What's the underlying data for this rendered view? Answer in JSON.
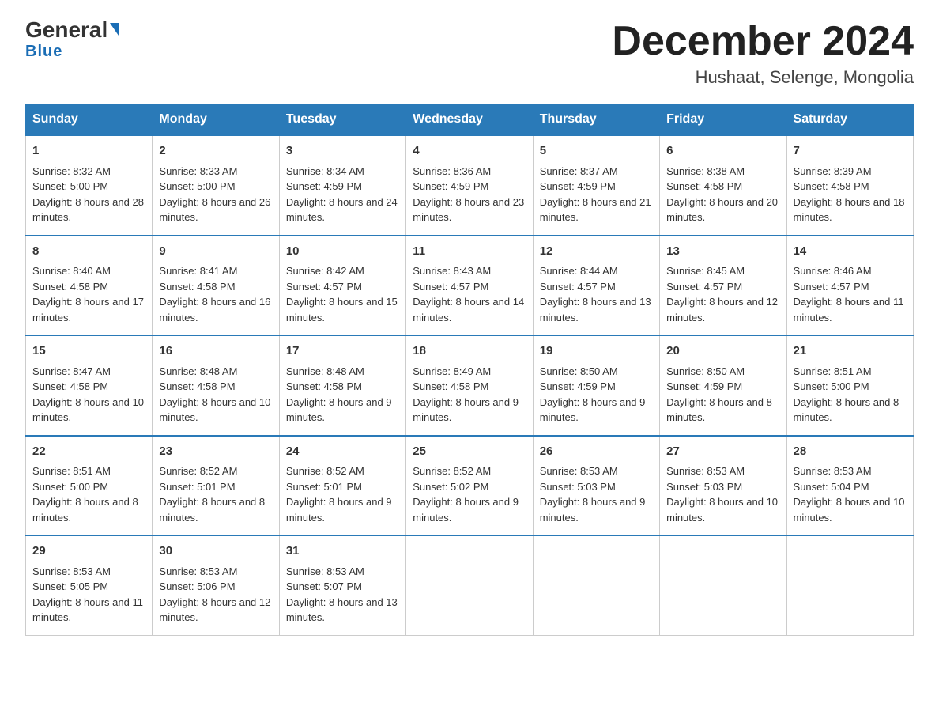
{
  "logo": {
    "general": "General",
    "blue": "Blue",
    "triangle_label": "logo-triangle"
  },
  "header": {
    "month_title": "December 2024",
    "location": "Hushaat, Selenge, Mongolia"
  },
  "days_of_week": [
    "Sunday",
    "Monday",
    "Tuesday",
    "Wednesday",
    "Thursday",
    "Friday",
    "Saturday"
  ],
  "weeks": [
    [
      {
        "day": "1",
        "sunrise": "Sunrise: 8:32 AM",
        "sunset": "Sunset: 5:00 PM",
        "daylight": "Daylight: 8 hours and 28 minutes."
      },
      {
        "day": "2",
        "sunrise": "Sunrise: 8:33 AM",
        "sunset": "Sunset: 5:00 PM",
        "daylight": "Daylight: 8 hours and 26 minutes."
      },
      {
        "day": "3",
        "sunrise": "Sunrise: 8:34 AM",
        "sunset": "Sunset: 4:59 PM",
        "daylight": "Daylight: 8 hours and 24 minutes."
      },
      {
        "day": "4",
        "sunrise": "Sunrise: 8:36 AM",
        "sunset": "Sunset: 4:59 PM",
        "daylight": "Daylight: 8 hours and 23 minutes."
      },
      {
        "day": "5",
        "sunrise": "Sunrise: 8:37 AM",
        "sunset": "Sunset: 4:59 PM",
        "daylight": "Daylight: 8 hours and 21 minutes."
      },
      {
        "day": "6",
        "sunrise": "Sunrise: 8:38 AM",
        "sunset": "Sunset: 4:58 PM",
        "daylight": "Daylight: 8 hours and 20 minutes."
      },
      {
        "day": "7",
        "sunrise": "Sunrise: 8:39 AM",
        "sunset": "Sunset: 4:58 PM",
        "daylight": "Daylight: 8 hours and 18 minutes."
      }
    ],
    [
      {
        "day": "8",
        "sunrise": "Sunrise: 8:40 AM",
        "sunset": "Sunset: 4:58 PM",
        "daylight": "Daylight: 8 hours and 17 minutes."
      },
      {
        "day": "9",
        "sunrise": "Sunrise: 8:41 AM",
        "sunset": "Sunset: 4:58 PM",
        "daylight": "Daylight: 8 hours and 16 minutes."
      },
      {
        "day": "10",
        "sunrise": "Sunrise: 8:42 AM",
        "sunset": "Sunset: 4:57 PM",
        "daylight": "Daylight: 8 hours and 15 minutes."
      },
      {
        "day": "11",
        "sunrise": "Sunrise: 8:43 AM",
        "sunset": "Sunset: 4:57 PM",
        "daylight": "Daylight: 8 hours and 14 minutes."
      },
      {
        "day": "12",
        "sunrise": "Sunrise: 8:44 AM",
        "sunset": "Sunset: 4:57 PM",
        "daylight": "Daylight: 8 hours and 13 minutes."
      },
      {
        "day": "13",
        "sunrise": "Sunrise: 8:45 AM",
        "sunset": "Sunset: 4:57 PM",
        "daylight": "Daylight: 8 hours and 12 minutes."
      },
      {
        "day": "14",
        "sunrise": "Sunrise: 8:46 AM",
        "sunset": "Sunset: 4:57 PM",
        "daylight": "Daylight: 8 hours and 11 minutes."
      }
    ],
    [
      {
        "day": "15",
        "sunrise": "Sunrise: 8:47 AM",
        "sunset": "Sunset: 4:58 PM",
        "daylight": "Daylight: 8 hours and 10 minutes."
      },
      {
        "day": "16",
        "sunrise": "Sunrise: 8:48 AM",
        "sunset": "Sunset: 4:58 PM",
        "daylight": "Daylight: 8 hours and 10 minutes."
      },
      {
        "day": "17",
        "sunrise": "Sunrise: 8:48 AM",
        "sunset": "Sunset: 4:58 PM",
        "daylight": "Daylight: 8 hours and 9 minutes."
      },
      {
        "day": "18",
        "sunrise": "Sunrise: 8:49 AM",
        "sunset": "Sunset: 4:58 PM",
        "daylight": "Daylight: 8 hours and 9 minutes."
      },
      {
        "day": "19",
        "sunrise": "Sunrise: 8:50 AM",
        "sunset": "Sunset: 4:59 PM",
        "daylight": "Daylight: 8 hours and 9 minutes."
      },
      {
        "day": "20",
        "sunrise": "Sunrise: 8:50 AM",
        "sunset": "Sunset: 4:59 PM",
        "daylight": "Daylight: 8 hours and 8 minutes."
      },
      {
        "day": "21",
        "sunrise": "Sunrise: 8:51 AM",
        "sunset": "Sunset: 5:00 PM",
        "daylight": "Daylight: 8 hours and 8 minutes."
      }
    ],
    [
      {
        "day": "22",
        "sunrise": "Sunrise: 8:51 AM",
        "sunset": "Sunset: 5:00 PM",
        "daylight": "Daylight: 8 hours and 8 minutes."
      },
      {
        "day": "23",
        "sunrise": "Sunrise: 8:52 AM",
        "sunset": "Sunset: 5:01 PM",
        "daylight": "Daylight: 8 hours and 8 minutes."
      },
      {
        "day": "24",
        "sunrise": "Sunrise: 8:52 AM",
        "sunset": "Sunset: 5:01 PM",
        "daylight": "Daylight: 8 hours and 9 minutes."
      },
      {
        "day": "25",
        "sunrise": "Sunrise: 8:52 AM",
        "sunset": "Sunset: 5:02 PM",
        "daylight": "Daylight: 8 hours and 9 minutes."
      },
      {
        "day": "26",
        "sunrise": "Sunrise: 8:53 AM",
        "sunset": "Sunset: 5:03 PM",
        "daylight": "Daylight: 8 hours and 9 minutes."
      },
      {
        "day": "27",
        "sunrise": "Sunrise: 8:53 AM",
        "sunset": "Sunset: 5:03 PM",
        "daylight": "Daylight: 8 hours and 10 minutes."
      },
      {
        "day": "28",
        "sunrise": "Sunrise: 8:53 AM",
        "sunset": "Sunset: 5:04 PM",
        "daylight": "Daylight: 8 hours and 10 minutes."
      }
    ],
    [
      {
        "day": "29",
        "sunrise": "Sunrise: 8:53 AM",
        "sunset": "Sunset: 5:05 PM",
        "daylight": "Daylight: 8 hours and 11 minutes."
      },
      {
        "day": "30",
        "sunrise": "Sunrise: 8:53 AM",
        "sunset": "Sunset: 5:06 PM",
        "daylight": "Daylight: 8 hours and 12 minutes."
      },
      {
        "day": "31",
        "sunrise": "Sunrise: 8:53 AM",
        "sunset": "Sunset: 5:07 PM",
        "daylight": "Daylight: 8 hours and 13 minutes."
      },
      null,
      null,
      null,
      null
    ]
  ]
}
